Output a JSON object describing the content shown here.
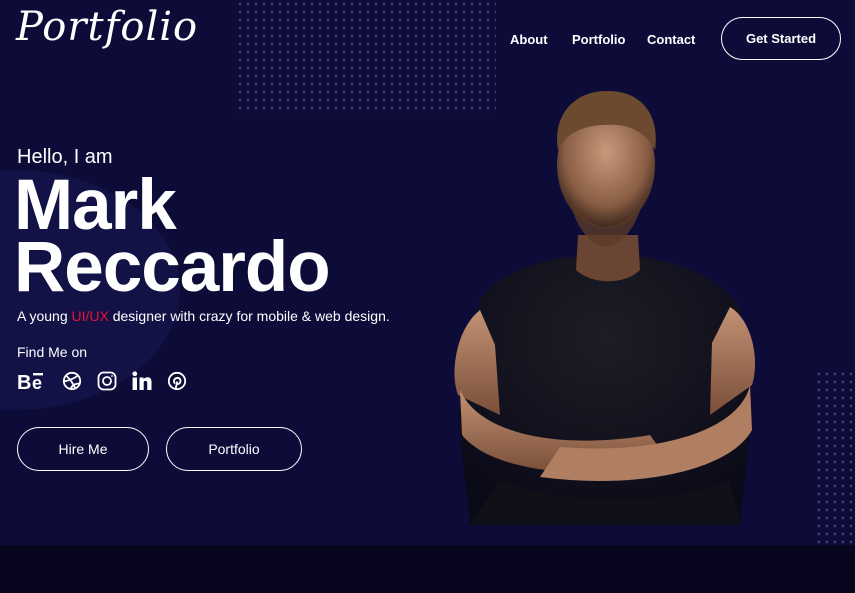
{
  "brand": {
    "logo_text": "Portfolio"
  },
  "nav": {
    "links": [
      "About",
      "Portfolio",
      "Contact"
    ],
    "cta_label": "Get Started"
  },
  "hero": {
    "greeting": "Hello, I am",
    "name_line1": "Mark",
    "name_line2": "Reccardo",
    "tagline_before": "A young ",
    "tagline_highlight": "UI/UX",
    "tagline_after": " designer with crazy for mobile & web design.",
    "find_me_label": "Find Me on",
    "socials": [
      "behance-icon",
      "dribbble-icon",
      "instagram-icon",
      "linkedin-icon",
      "pinterest-icon"
    ],
    "buttons": {
      "hire_me": "Hire Me",
      "portfolio": "Portfolio"
    }
  },
  "colors": {
    "background": "#0d0c38",
    "footer_band": "#07061e",
    "accent": "#e8123a",
    "text": "#ffffff"
  }
}
